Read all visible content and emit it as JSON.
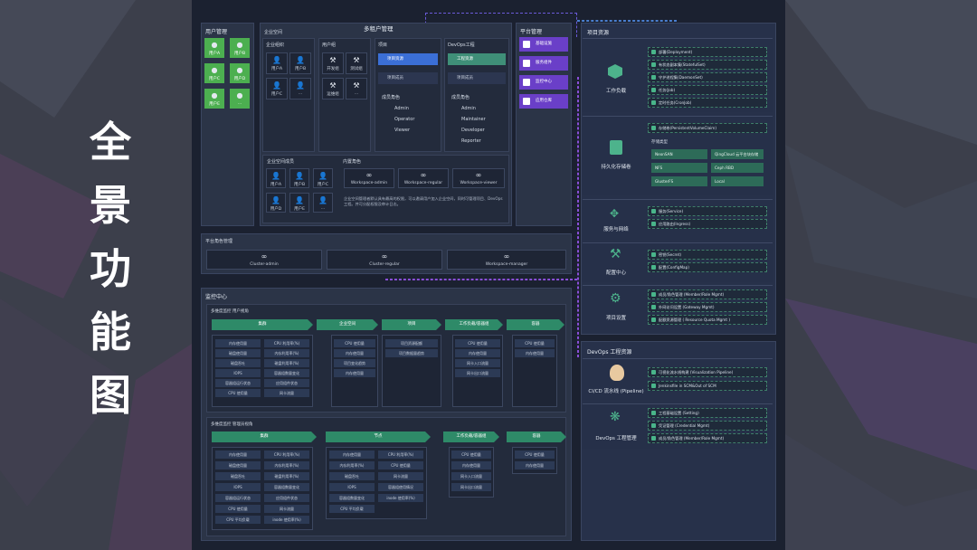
{
  "side_title": [
    "全",
    "景",
    "功",
    "能",
    "图"
  ],
  "tenant": {
    "header": "用户管理",
    "users": [
      "用户A",
      "用户B",
      "用户C",
      "用户D",
      "用户E",
      "..."
    ]
  },
  "multi": {
    "title": "多租户管理",
    "enterprise_space": "企业空间",
    "org": {
      "title": "企业组织",
      "users": [
        "用户A",
        "用户B",
        "用户C",
        "..."
      ]
    },
    "member": {
      "title": "用户组",
      "items": [
        "开发组",
        "测试组",
        "运维组",
        "..."
      ]
    },
    "project": {
      "title": "项目",
      "chip1": "项目资源",
      "chip2": "项目成员",
      "roles_title": "成员角色",
      "roles": [
        "Admin",
        "Operator",
        "Viewer"
      ]
    },
    "devops": {
      "title": "DevOps工程",
      "chip1": "工程资源",
      "chip2": "项目成员",
      "roles_title": "成员角色",
      "roles": [
        "Admin",
        "Maintainer",
        "Developer",
        "Reporter"
      ]
    },
    "ws": {
      "left_title": "企业空间成员",
      "left_users": [
        "用户A",
        "用户B",
        "用户C",
        "用户D",
        "用户E",
        "..."
      ],
      "right_title": "内置角色",
      "roles": [
        "Workspace-admin",
        "Workspace-regular",
        "Workspace-viewer"
      ],
      "desc": "企业空间管理者默认具有最高的权限，可以邀请用户加入企业空间，同时可管理项目、DevOps工程。并可分配权限及审计日志。"
    }
  },
  "platform": {
    "header": "平台管理",
    "items": [
      "基础设施",
      "服务组件",
      "监控中心",
      "应用仓库"
    ]
  },
  "platform_roles": {
    "title": "平台角色管理",
    "roles": [
      "Cluster-admin",
      "Cluster-regular",
      "Workspace-manager"
    ]
  },
  "monitor": {
    "title": "监控中心",
    "top": {
      "title": "多维度监控 用户视角",
      "arrows": [
        "集群",
        "企业空间",
        "项目",
        "工作负载/容器组",
        "容器"
      ],
      "cluster_items": [
        [
          "内存使用量",
          "CPU 利用率(%)"
        ],
        [
          "磁盘使用量",
          "内存利用率(%)"
        ],
        [
          "磁盘吞吐",
          "磁盘利用率(%)"
        ],
        [
          "IOPS",
          "容器组数量变化"
        ],
        [
          "容器组运行状态",
          "应用组件状态"
        ],
        [
          "CPU 使用量",
          "网卡流量"
        ]
      ],
      "ws_items": [
        "CPU 使用量",
        "内存使用量",
        "项目变化趋势",
        "内存使用量"
      ],
      "proj_items": [
        "项目资源配额",
        "项目数据量趋势"
      ],
      "wl_items": [
        "CPU 使用量",
        "内存使用量",
        "网卡入口流量",
        "网卡出口流量"
      ],
      "ctr_items": [
        "CPU 使用量",
        "内存使用量"
      ]
    },
    "bottom": {
      "title": "多维度监控 管理员视角",
      "arrows": [
        "集群",
        "节点",
        "工作负载/容器组",
        "容器"
      ],
      "cluster_items": [
        [
          "内存使用量",
          "CPU 利用率(%)"
        ],
        [
          "磁盘使用量",
          "内存利用率(%)"
        ],
        [
          "磁盘吞吐",
          "磁盘利用率(%)"
        ],
        [
          "IOPS",
          "容器组数量变化"
        ],
        [
          "容器组运行状态",
          "应用组件状态"
        ],
        [
          "CPU 使用量",
          "网卡流量"
        ],
        [
          "CPU 平均负载",
          "inode 使用率(%)"
        ]
      ],
      "node_items": [
        [
          "内存使用量",
          "CPU 利用率(%)"
        ],
        [
          "内存利用率(%)",
          "CPU 使用量"
        ],
        [
          "磁盘吞吐",
          "网卡流量"
        ],
        [
          "IOPS",
          "容器组使用情况"
        ],
        [
          "容器组数量变化",
          "inode 使用率(%)"
        ],
        [
          "CPU 平均负载",
          ""
        ]
      ],
      "wl_items": [
        "CPU 使用量",
        "内存使用量",
        "网卡入口流量",
        "网卡出口流量"
      ],
      "ctr_items": [
        "CPU 使用量",
        "内存使用量"
      ]
    }
  },
  "resources": {
    "title": "项目资源",
    "workload": {
      "label": "工作负载",
      "items": [
        "部署(Deployment)",
        "有状态副本集(StatefulSet)",
        "守护进程集(DaemonSet)",
        "任务(Job)",
        "定时任务(CronJob)"
      ]
    },
    "storage": {
      "label": "持久化存储卷",
      "pvc": "存储卷(PersistentVolumeClaim)",
      "types_title": "存储类型",
      "types": [
        "NeonSAN",
        "QingCloud 云平台块存储",
        "NFS",
        "Ceph RBD",
        "GlusterFS",
        "Local"
      ]
    },
    "network": {
      "label": "服务与网络",
      "items": [
        "服务(Service)",
        "应用路由(Ingress)"
      ]
    },
    "config": {
      "label": "配置中心",
      "items": [
        "密钥(Secret)",
        "配置(ConfigMap)"
      ]
    },
    "settings": {
      "label": "项目设置",
      "items": [
        "成员/角色管理 (Member/Role Mgmt)",
        "外网访问设置 (Gateway Mgmt)",
        "配额资源管理 ( Resource Quota Mgmt )"
      ]
    }
  },
  "devops_res": {
    "title": "DevOps 工程资源",
    "pipeline": {
      "label": "CI/CD 流水线 (Pipeline)",
      "items": [
        "可视化流水线构建 (Visualization Pipeline)",
        "Jenkinsfile in SCM&Out of SCM"
      ]
    },
    "mgmt": {
      "label": "DevOps 工程管理",
      "items": [
        "工程基础设置 (Setting)",
        "凭证管理 (Credential Mgmt)",
        "成员/角色管理 (Member/Role Mgmt)"
      ]
    }
  }
}
